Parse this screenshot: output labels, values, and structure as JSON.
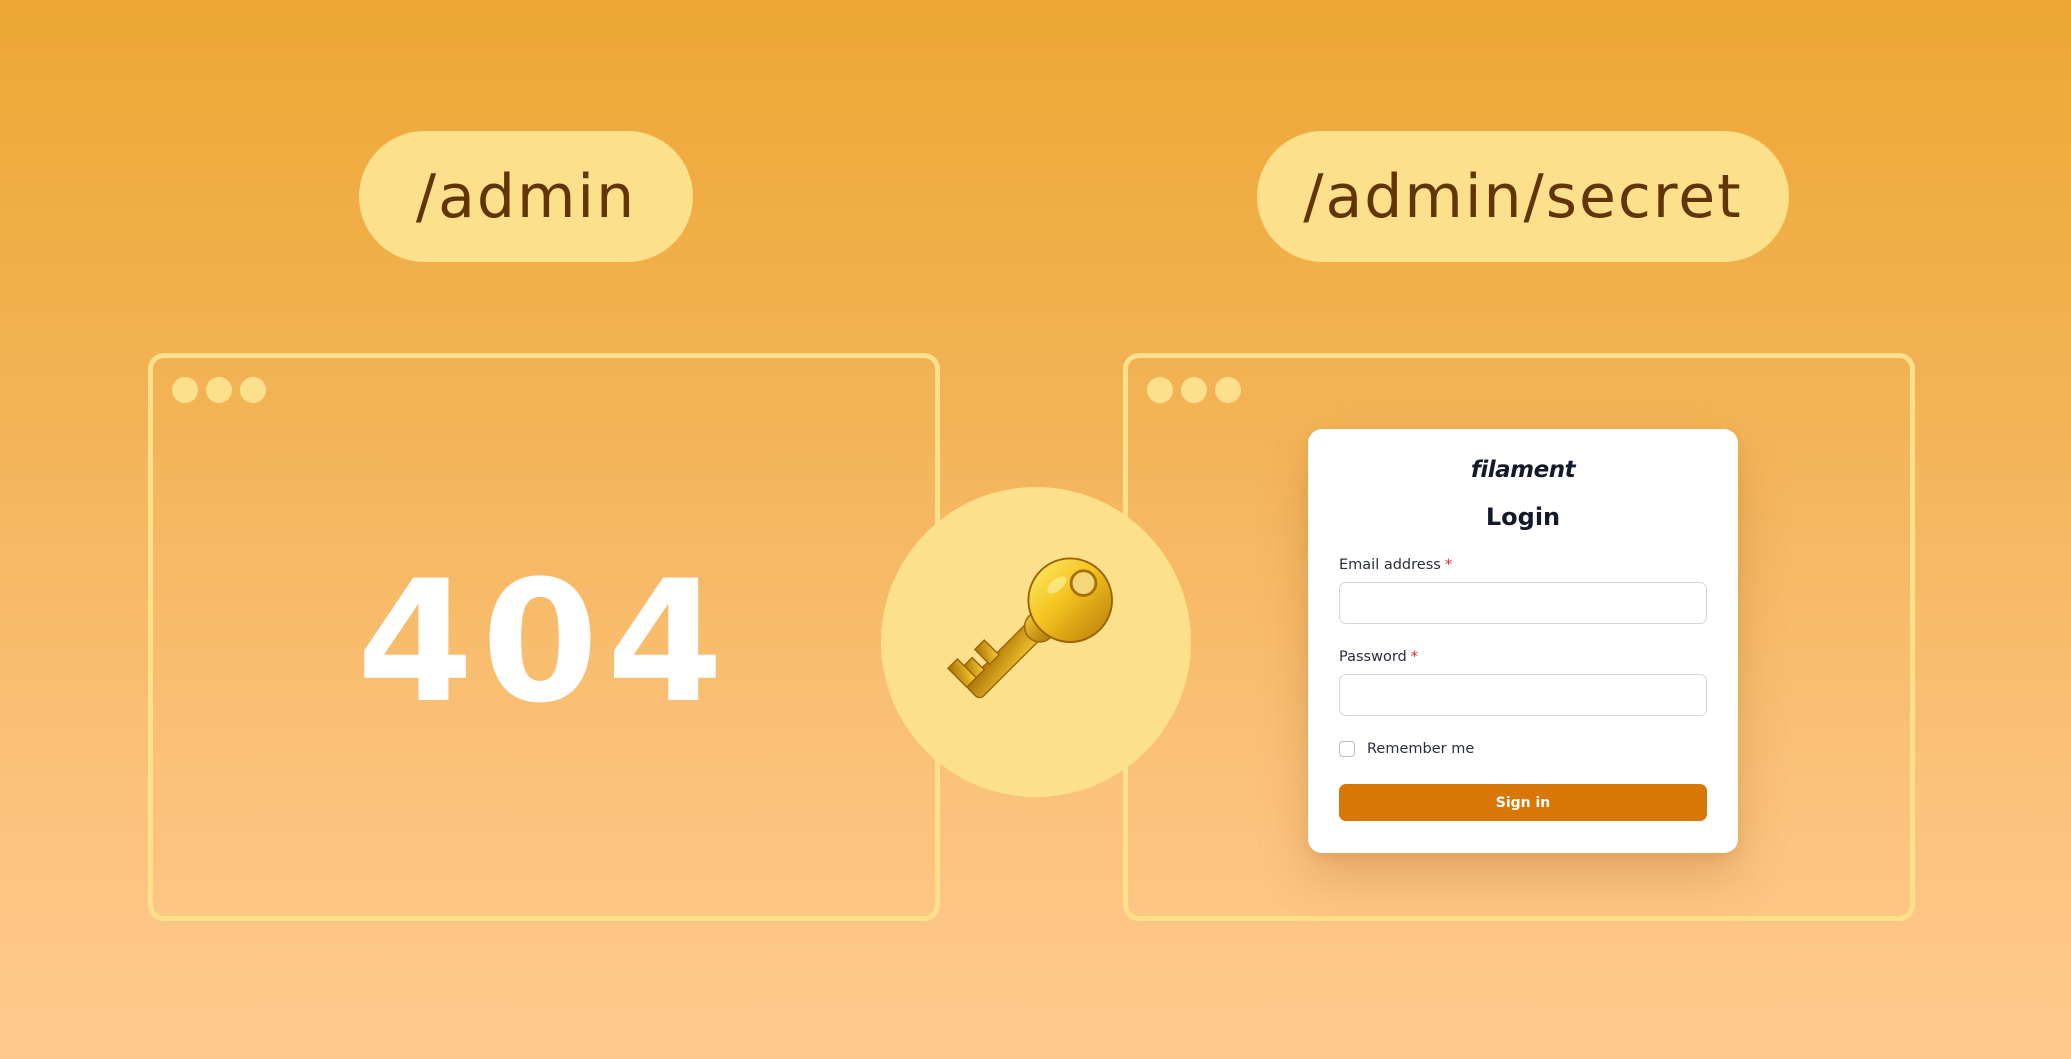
{
  "route_labels": {
    "left": "/admin",
    "right": "/admin/secret"
  },
  "left_window": {
    "error_code": "404"
  },
  "key_badge": {
    "icon": "key-icon"
  },
  "login_card": {
    "brand": "filament",
    "title": "Login",
    "email_label": "Email address",
    "email_value": "",
    "password_label": "Password",
    "password_value": "",
    "required_marker": "*",
    "remember_label": "Remember me",
    "remember_checked": false,
    "signin_label": "Sign in"
  },
  "colors": {
    "accent": "#d97706",
    "pill_background": "#fde08c",
    "pill_text": "#613509",
    "required": "#dc2626"
  }
}
